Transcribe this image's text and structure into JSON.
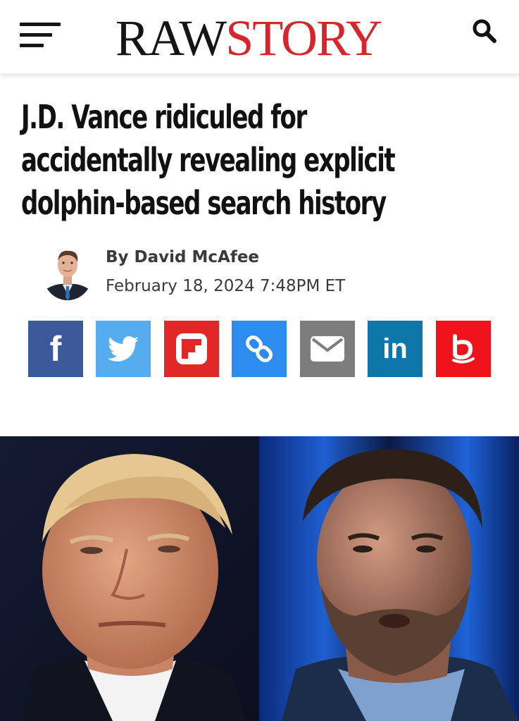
{
  "header": {
    "logo_part1": "RAW",
    "logo_part2": "STORY",
    "menu_icon": "hamburger-menu-icon",
    "search_icon": "search-icon"
  },
  "article": {
    "headline_line1": "J.D. Vance ridiculed for",
    "headline_line2": "accidentally revealing explicit",
    "headline_line3": "dolphin-based search history",
    "byline": "By David McAfee",
    "date": "February 18, 2024 7:48PM ET"
  },
  "share": {
    "buttons": [
      {
        "icon": "facebook-icon",
        "label": "f",
        "color": "#3b5998"
      },
      {
        "icon": "twitter-icon",
        "color": "#55acee"
      },
      {
        "icon": "flipboard-icon",
        "color": "#e12828"
      },
      {
        "icon": "link-icon",
        "color": "#2d8cf0"
      },
      {
        "icon": "email-icon",
        "color": "#7d7d7d"
      },
      {
        "icon": "linkedin-icon",
        "label": "in",
        "color": "#0e76a8"
      },
      {
        "icon": "bluesky-icon",
        "color": "#f1131c"
      }
    ]
  },
  "colors": {
    "brand_red": "#d6262c",
    "text_dark": "#111111",
    "meta_gray": "#3a3a3a"
  }
}
